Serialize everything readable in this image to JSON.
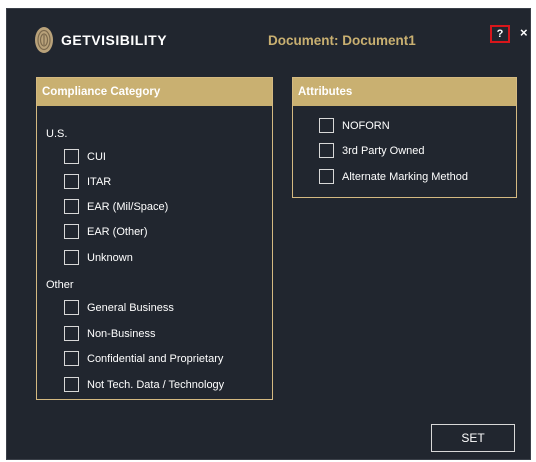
{
  "header": {
    "brand": "GETVISIBILITY",
    "document_title": "Document: Document1",
    "help_label": "?",
    "close_label": "×"
  },
  "compliance": {
    "title": "Compliance Category",
    "us_label": "U.S.",
    "us_items": [
      {
        "label": "CUI",
        "checked": false
      },
      {
        "label": "ITAR",
        "checked": false
      },
      {
        "label": "EAR (Mil/Space)",
        "checked": false
      },
      {
        "label": "EAR (Other)",
        "checked": false
      },
      {
        "label": "Unknown",
        "checked": false
      }
    ],
    "other_label": "Other",
    "other_items": [
      {
        "label": "General Business",
        "checked": false
      },
      {
        "label": "Non-Business",
        "checked": false
      },
      {
        "label": "Confidential and Proprietary",
        "checked": false
      },
      {
        "label": "Not Tech. Data / Technology",
        "checked": false
      }
    ]
  },
  "attributes": {
    "title": "Attributes",
    "items": [
      {
        "label": "NOFORN",
        "checked": false
      },
      {
        "label": "3rd Party Owned",
        "checked": false
      },
      {
        "label": "Alternate Marking Method",
        "checked": false
      }
    ]
  },
  "actions": {
    "set_label": "SET"
  },
  "colors": {
    "background": "#21262f",
    "accent": "#c9b071",
    "help_border": "#d7161b"
  }
}
